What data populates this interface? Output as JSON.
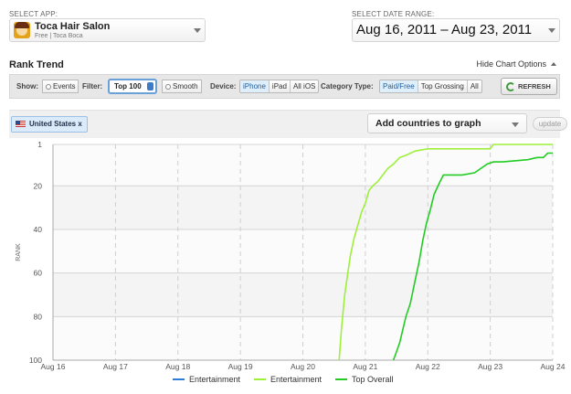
{
  "app_selector": {
    "label": "SELECT APP:",
    "app_name": "Toca Hair Salon",
    "app_sub": "Free | Toca Boca",
    "icon": "app-icon"
  },
  "date_selector": {
    "label": "SELECT DATE RANGE:",
    "value": "Aug 16, 2011 – Aug 23, 2011"
  },
  "section": {
    "title": "Rank Trend",
    "hide_options": "Hide Chart Options"
  },
  "toolbar": {
    "show_label": "Show:",
    "events": "Events",
    "filter_label": "Filter:",
    "filter_value": "Top 100",
    "smooth": "Smooth",
    "device_label": "Device:",
    "devices": [
      "iPhone",
      "iPad",
      "All iOS"
    ],
    "active_device": "iPhone",
    "category_label": "Category Type:",
    "categories": [
      "Paid/Free",
      "Top Grossing",
      "All"
    ],
    "active_category": "Paid/Free",
    "refresh": "REFRESH"
  },
  "countries": {
    "tag": "United States x",
    "add_placeholder": "Add countries to graph",
    "update": "update"
  },
  "colors": {
    "entertainment_blue": "#2d7ddc",
    "entertainment_lime": "#9ef03a",
    "top_overall": "#22cc22"
  },
  "chart_data": {
    "type": "line",
    "ylabel": "RANK",
    "y_reversed": true,
    "ylim": [
      1,
      100
    ],
    "yticks": [
      "1",
      "20",
      "40",
      "60",
      "80",
      "100"
    ],
    "ytick_values": [
      1,
      20,
      40,
      60,
      80,
      100
    ],
    "xticks": [
      "Aug 16",
      "Aug 17",
      "Aug 18",
      "Aug 19",
      "Aug 20",
      "Aug 21",
      "Aug 22",
      "Aug 23",
      "Aug 24"
    ],
    "xlim": [
      0,
      8
    ],
    "grid": true,
    "legend_position": "bottom",
    "series": [
      {
        "name": "Entertainment",
        "color": "#2d7ddc",
        "points": []
      },
      {
        "name": "Entertainment",
        "color": "#9ef03a",
        "points": [
          [
            4.58,
            100
          ],
          [
            4.62,
            85
          ],
          [
            4.67,
            70
          ],
          [
            4.72,
            60
          ],
          [
            4.76,
            52
          ],
          [
            4.82,
            44
          ],
          [
            4.88,
            38
          ],
          [
            4.94,
            32
          ],
          [
            5.0,
            28
          ],
          [
            5.06,
            22
          ],
          [
            5.12,
            20
          ],
          [
            5.2,
            18
          ],
          [
            5.28,
            15
          ],
          [
            5.36,
            12
          ],
          [
            5.45,
            10
          ],
          [
            5.55,
            7
          ],
          [
            5.65,
            6
          ],
          [
            5.8,
            4
          ],
          [
            6.0,
            3
          ],
          [
            6.5,
            3
          ],
          [
            7.0,
            3
          ],
          [
            7.05,
            1
          ],
          [
            7.5,
            1
          ],
          [
            8.0,
            1
          ]
        ]
      },
      {
        "name": "Top Overall",
        "color": "#22cc22",
        "points": [
          [
            5.45,
            100
          ],
          [
            5.5,
            96
          ],
          [
            5.55,
            92
          ],
          [
            5.6,
            86
          ],
          [
            5.65,
            80
          ],
          [
            5.72,
            74
          ],
          [
            5.8,
            63
          ],
          [
            5.86,
            55
          ],
          [
            5.92,
            45
          ],
          [
            5.98,
            37
          ],
          [
            6.04,
            31
          ],
          [
            6.1,
            24
          ],
          [
            6.18,
            19
          ],
          [
            6.25,
            15
          ],
          [
            6.35,
            15
          ],
          [
            6.55,
            15
          ],
          [
            6.75,
            14
          ],
          [
            6.95,
            10
          ],
          [
            7.05,
            9
          ],
          [
            7.2,
            9
          ],
          [
            7.6,
            8
          ],
          [
            7.75,
            7
          ],
          [
            7.85,
            7
          ],
          [
            7.92,
            5
          ],
          [
            8.0,
            5
          ]
        ]
      }
    ]
  }
}
